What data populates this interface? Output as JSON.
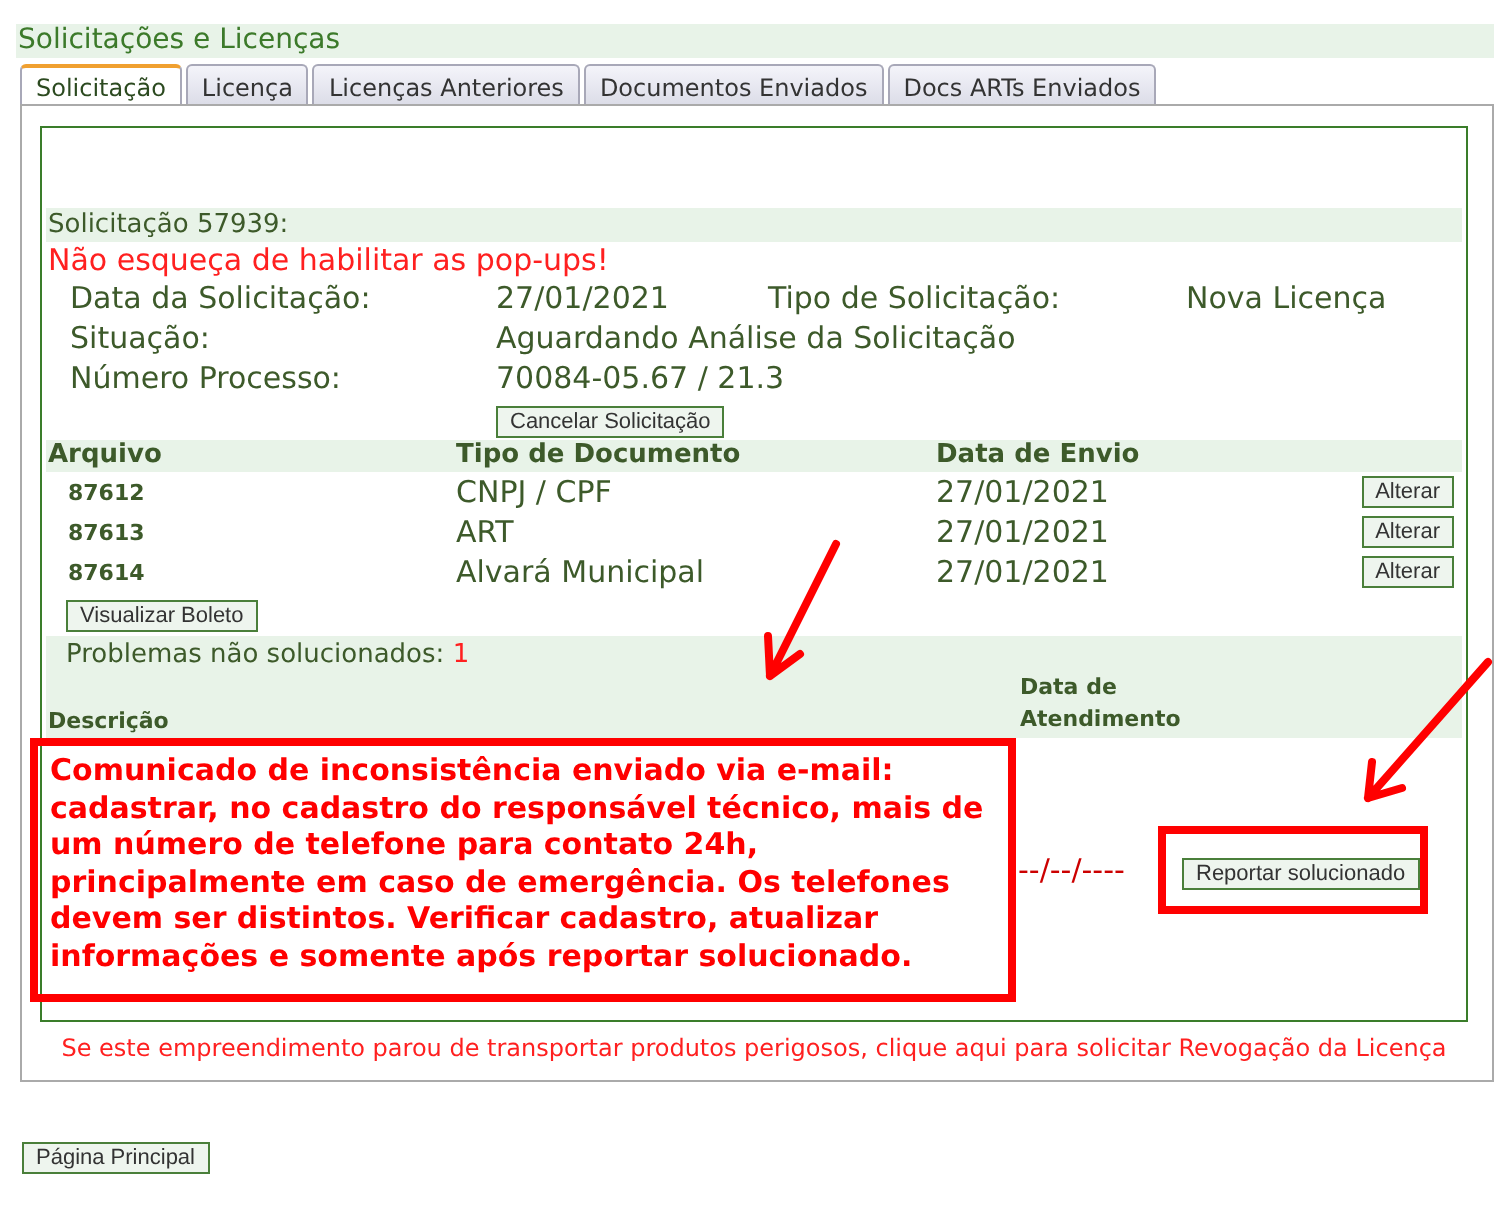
{
  "page_title": "Solicitações e Licenças",
  "tabs": [
    {
      "label": "Solicitação",
      "selected": true
    },
    {
      "label": "Licença",
      "selected": false
    },
    {
      "label": "Licenças Anteriores",
      "selected": false
    },
    {
      "label": "Documentos Enviados",
      "selected": false
    },
    {
      "label": "Docs ARTs Enviados",
      "selected": false
    }
  ],
  "request": {
    "heading": "Solicitação 57939:",
    "popup_warning": "Não esqueça de habilitar as pop-ups!",
    "detail_rows": [
      [
        {
          "label": "Data da Solicitação:",
          "value": "27/01/2021"
        },
        {
          "label": "Tipo de Solicitação:",
          "value": "Nova Licença"
        }
      ],
      [
        {
          "label": "Situação:",
          "value": "Aguardando Análise da Solicitação"
        }
      ],
      [
        {
          "label": "Número Processo:",
          "value": "70084-05.67 / 21.3"
        }
      ]
    ],
    "cancel_button": "Cancelar Solicitação"
  },
  "documents": {
    "columns": [
      "Arquivo",
      "Tipo de Documento",
      "Data de Envio"
    ],
    "rows": [
      {
        "file": "87612",
        "type": "CNPJ / CPF",
        "date": "27/01/2021",
        "action": "Alterar"
      },
      {
        "file": "87613",
        "type": "ART",
        "date": "27/01/2021",
        "action": "Alterar"
      },
      {
        "file": "87614",
        "type": "Alvará Municipal",
        "date": "27/01/2021",
        "action": "Alterar"
      }
    ],
    "boleto_button": "Visualizar Boleto"
  },
  "problems": {
    "label": "Problemas não solucionados:",
    "count": "1",
    "columns": [
      "Descrição",
      "Data de Atendimento"
    ],
    "rows": [
      {
        "description": "Comunicado de inconsistência enviado via e-mail: cadastrar, no cadastro do responsável técnico, mais de um número de telefone para contato 24h, principalmente em caso de emergência. Os telefones devem ser distintos. Verificar cadastro, atualizar informações e somente após reportar solucionado.",
        "date": "--/--/----",
        "action": "Reportar solucionado"
      }
    ]
  },
  "revocation_link": "Se este empreendimento parou de transportar produtos perigosos, clique aqui para solicitar Revogação da Licença",
  "main_page_button": "Página Principal"
}
